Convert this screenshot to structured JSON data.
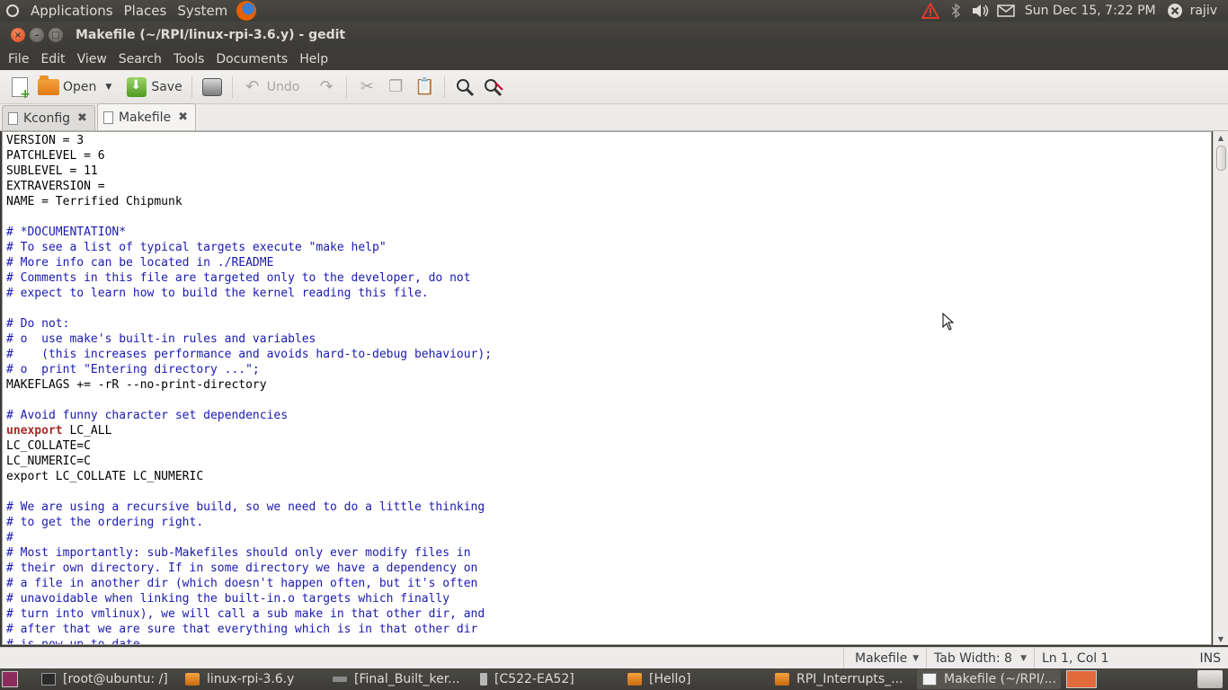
{
  "top_panel": {
    "menus": [
      "Applications",
      "Places",
      "System"
    ],
    "clock": "Sun Dec 15,  7:22 PM",
    "user": "rajiv",
    "icons": [
      "ubuntu-logo",
      "firefox-icon",
      "warning-icon",
      "bluetooth-icon",
      "volume-icon",
      "mail-icon",
      "session-icon"
    ]
  },
  "window": {
    "title": "Makefile (~/RPI/linux-rpi-3.6.y) - gedit"
  },
  "menubar": [
    "File",
    "Edit",
    "View",
    "Search",
    "Tools",
    "Documents",
    "Help"
  ],
  "toolbar": {
    "open_label": "Open",
    "save_label": "Save",
    "undo_label": "Undo"
  },
  "tabs": [
    {
      "label": "Kconfig",
      "active": false
    },
    {
      "label": "Makefile",
      "active": true
    }
  ],
  "editor_lines": [
    {
      "text": "VERSION = 3",
      "type": "plain"
    },
    {
      "text": "PATCHLEVEL = 6",
      "type": "plain"
    },
    {
      "text": "SUBLEVEL = 11",
      "type": "plain"
    },
    {
      "text": "EXTRAVERSION =",
      "type": "plain"
    },
    {
      "text": "NAME = Terrified Chipmunk",
      "type": "plain"
    },
    {
      "text": "",
      "type": "plain"
    },
    {
      "text": "# *DOCUMENTATION*",
      "type": "comment"
    },
    {
      "text": "# To see a list of typical targets execute \"make help\"",
      "type": "comment"
    },
    {
      "text": "# More info can be located in ./README",
      "type": "comment"
    },
    {
      "text": "# Comments in this file are targeted only to the developer, do not",
      "type": "comment"
    },
    {
      "text": "# expect to learn how to build the kernel reading this file.",
      "type": "comment"
    },
    {
      "text": "",
      "type": "plain"
    },
    {
      "text": "# Do not:",
      "type": "comment"
    },
    {
      "text": "# o  use make's built-in rules and variables",
      "type": "comment"
    },
    {
      "text": "#    (this increases performance and avoids hard-to-debug behaviour);",
      "type": "comment"
    },
    {
      "text": "# o  print \"Entering directory ...\";",
      "type": "comment"
    },
    {
      "text": "MAKEFLAGS += -rR --no-print-directory",
      "type": "plain"
    },
    {
      "text": "",
      "type": "plain"
    },
    {
      "text": "# Avoid funny character set dependencies",
      "type": "comment"
    },
    {
      "text": "unexport",
      "type": "keyword",
      "rest": " LC_ALL"
    },
    {
      "text": "LC_COLLATE=C",
      "type": "plain"
    },
    {
      "text": "LC_NUMERIC=C",
      "type": "plain"
    },
    {
      "text": "export LC_COLLATE LC_NUMERIC",
      "type": "plain"
    },
    {
      "text": "",
      "type": "plain"
    },
    {
      "text": "# We are using a recursive build, so we need to do a little thinking",
      "type": "comment"
    },
    {
      "text": "# to get the ordering right.",
      "type": "comment"
    },
    {
      "text": "#",
      "type": "comment"
    },
    {
      "text": "# Most importantly: sub-Makefiles should only ever modify files in",
      "type": "comment"
    },
    {
      "text": "# their own directory. If in some directory we have a dependency on",
      "type": "comment"
    },
    {
      "text": "# a file in another dir (which doesn't happen often, but it's often",
      "type": "comment"
    },
    {
      "text": "# unavoidable when linking the built-in.o targets which finally",
      "type": "comment"
    },
    {
      "text": "# turn into vmlinux), we will call a sub make in that other dir, and",
      "type": "comment"
    },
    {
      "text": "# after that we are sure that everything which is in that other dir",
      "type": "comment"
    },
    {
      "text": "# is now up to date.",
      "type": "comment"
    }
  ],
  "statusbar": {
    "language": "Makefile",
    "tab_width": "Tab Width: 8",
    "position": "Ln 1, Col 1",
    "mode": "INS"
  },
  "taskbar": [
    {
      "label": "[root@ubuntu: /]",
      "icon": "terminal-icon",
      "active": false
    },
    {
      "label": "linux-rpi-3.6.y",
      "icon": "folder-icon",
      "active": false
    },
    {
      "label": "[Final_Built_ker...",
      "icon": "drive-icon",
      "active": false
    },
    {
      "label": "[C522-EA52]",
      "icon": "usb-drive-icon",
      "active": false
    },
    {
      "label": "[Hello]",
      "icon": "folder-icon",
      "active": false
    },
    {
      "label": "RPI_Interrupts_...",
      "icon": "folder-icon",
      "active": false
    },
    {
      "label": "Makefile (~/RPI/...",
      "icon": "text-editor-icon",
      "active": true
    }
  ]
}
